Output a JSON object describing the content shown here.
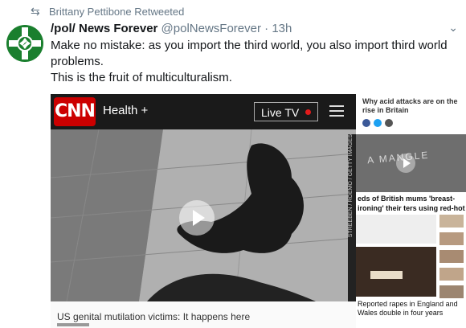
{
  "retweet": {
    "text": "Brittany Pettibone Retweeted",
    "icon": "retweet-icon"
  },
  "author": {
    "name": "/pol/ News Forever",
    "handle": "@polNewsForever",
    "time": "13h",
    "dot": "·"
  },
  "tweet": {
    "line1": "Make no mistake: as you import the third world, you also import third world problems.",
    "line2": "This is the fruit of multiculturalism."
  },
  "card": {
    "brand": "CNN",
    "section": "Health +",
    "live_label": "Live TV",
    "video_caption": "US genital mutilation victims: It happens here",
    "side_credit": "STREEBEN / ROEMO / GETTY IMAGES",
    "right_panel": {
      "acid_title": "Why acid attacks are on the rise in Britain",
      "sign_text": "A MANGLE",
      "breast_headline": "eds of British mums 'breast-ironing' their ters using red-hot rocks, hammers and",
      "raped_headline": "Reported rapes in England and Wales double in four years"
    }
  },
  "colors": {
    "cnn_red": "#cc0000",
    "live_dot": "#e21b1b",
    "meta_gray": "#657786"
  }
}
